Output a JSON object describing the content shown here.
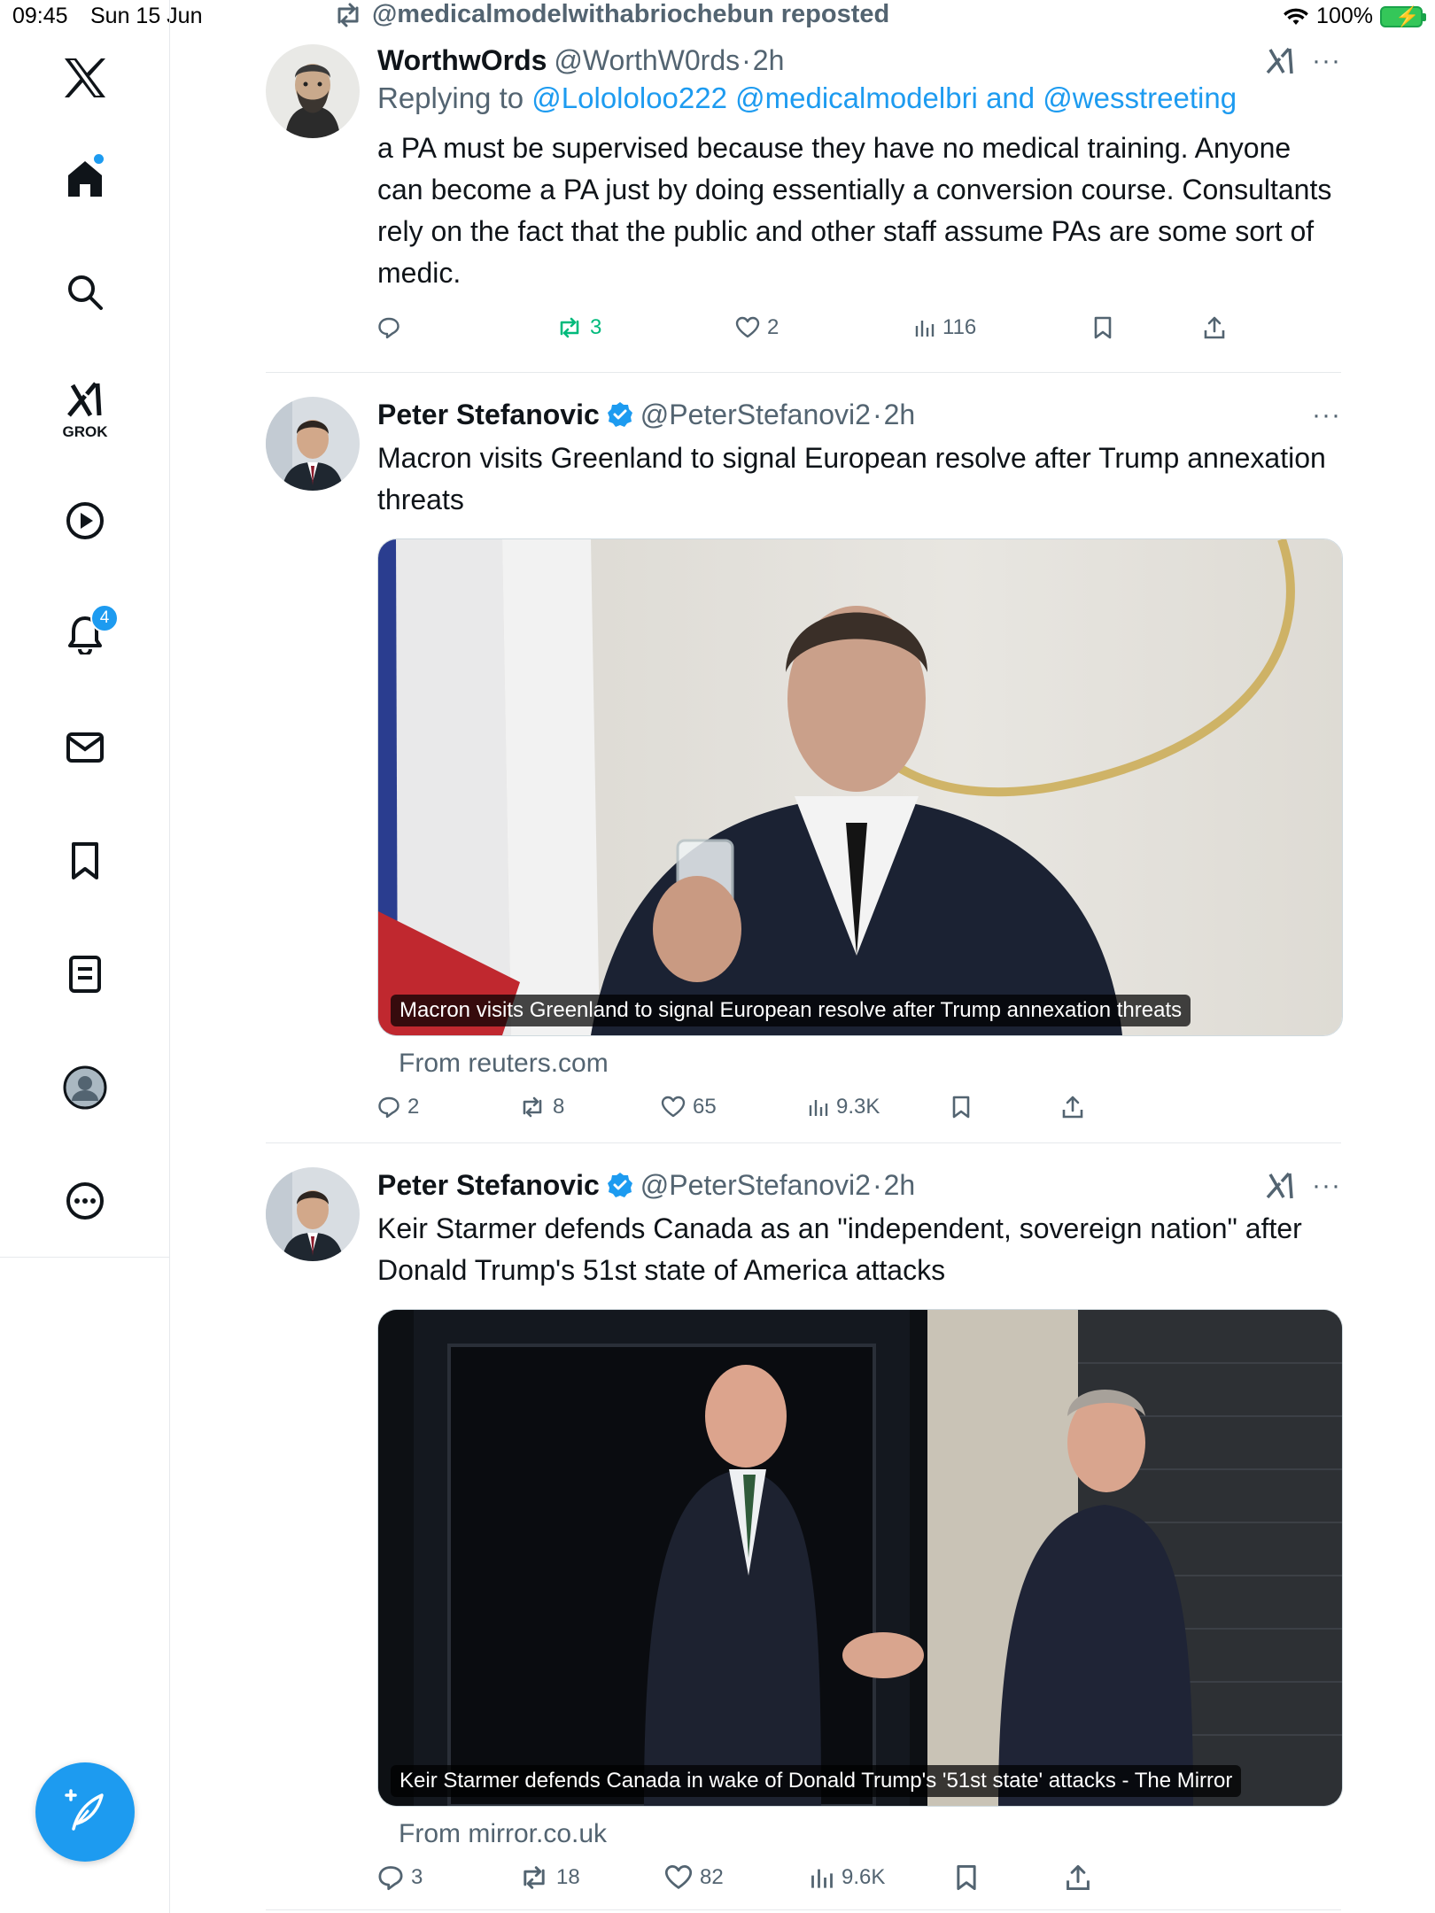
{
  "status_bar": {
    "time": "09:45",
    "date": "Sun 15 Jun",
    "battery": "100%"
  },
  "sidebar": {
    "logo": "x-logo-icon",
    "items": [
      {
        "name": "home",
        "icon": "home-icon"
      },
      {
        "name": "search",
        "icon": "search-icon"
      },
      {
        "name": "grok",
        "icon": "grok-icon",
        "label": "GROK"
      },
      {
        "name": "video",
        "icon": "play-icon"
      },
      {
        "name": "notifications",
        "icon": "bell-icon",
        "badge": "4"
      },
      {
        "name": "messages",
        "icon": "mail-icon"
      },
      {
        "name": "bookmarks",
        "icon": "bookmark-icon"
      },
      {
        "name": "lists",
        "icon": "list-icon"
      },
      {
        "name": "profile",
        "icon": "avatar-icon"
      },
      {
        "name": "more",
        "icon": "more-icon"
      }
    ],
    "compose_icon": "compose-icon"
  },
  "repost_header": "@medicalmodelwithabriochebun reposted",
  "posts": [
    {
      "name": "WorthwOrds",
      "handle": "@WorthW0rds",
      "time": "2h",
      "reply_prefix": "Replying to",
      "reply_to_1": "@Lolololoo222",
      "reply_to_2": "@medicalmodelbri",
      "reply_and": "and",
      "reply_to_3": "@wesstreeting",
      "text": "a PA must be supervised because they have no medical training. Anyone can become a PA just by doing essentially a conversion course. Consultants rely on the fact that the public and other staff assume PAs are some sort of medic.",
      "replies": "",
      "reposts": "3",
      "likes": "2",
      "views": "116",
      "repost_color": "#00ba7c"
    },
    {
      "name": "Peter Stefanovic",
      "handle": "@PeterStefanovi2",
      "time": "2h",
      "text": "Macron visits Greenland to signal European resolve after Trump annexation threats",
      "card_caption": "Macron visits Greenland to signal European resolve after Trump annexation threats",
      "card_source": "From reuters.com",
      "replies": "2",
      "reposts": "8",
      "likes": "65",
      "views": "9.3K"
    },
    {
      "name": "Peter Stefanovic",
      "handle": "@PeterStefanovi2",
      "time": "2h",
      "text": "Keir Starmer defends Canada as an \"independent, sovereign nation\" after Donald Trump's 51st state of America attacks",
      "card_caption": "Keir Starmer defends Canada in wake of Donald Trump's '51st state' attacks - The Mirror",
      "card_source": "From mirror.co.uk",
      "replies": "3",
      "reposts": "18",
      "likes": "82",
      "views": "9.6K"
    }
  ],
  "colors": {
    "accent": "#1d9bf0",
    "text": "#0f1419",
    "secondary": "#536471",
    "repost_active": "#00ba7c"
  }
}
